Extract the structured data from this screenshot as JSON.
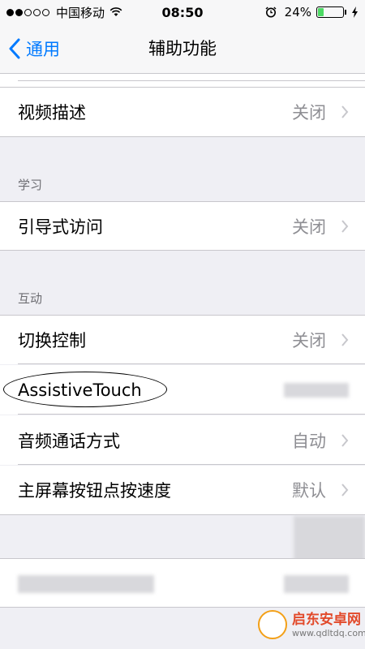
{
  "status_bar": {
    "carrier": "中国移动",
    "time": "08:50",
    "battery_percent_label": "24%",
    "battery_level": 0.24,
    "battery_color": "#4cd964"
  },
  "nav": {
    "back_label": "通用",
    "title": "辅助功能",
    "accent_color": "#007aff"
  },
  "sections": {
    "learning_header": "学习",
    "interaction_header": "互动"
  },
  "rows": {
    "audio_description": {
      "label": "视频描述",
      "value": "关闭"
    },
    "guided_access": {
      "label": "引导式访问",
      "value": "关闭"
    },
    "switch_control": {
      "label": "切换控制",
      "value": "关闭"
    },
    "assistive_touch": {
      "label": "AssistiveTouch"
    },
    "call_audio_routing": {
      "label": "音频通话方式",
      "value": "自动"
    },
    "home_click_speed": {
      "label": "主屏幕按钮点按速度",
      "value": "默认"
    }
  },
  "watermark": {
    "name": "启东安卓网",
    "url": "www.qdltdq.com"
  },
  "icons": [
    "wifi-icon",
    "alarm-icon",
    "battery-icon",
    "charging-icon",
    "back-chevron-icon",
    "chevron-right-icon"
  ]
}
